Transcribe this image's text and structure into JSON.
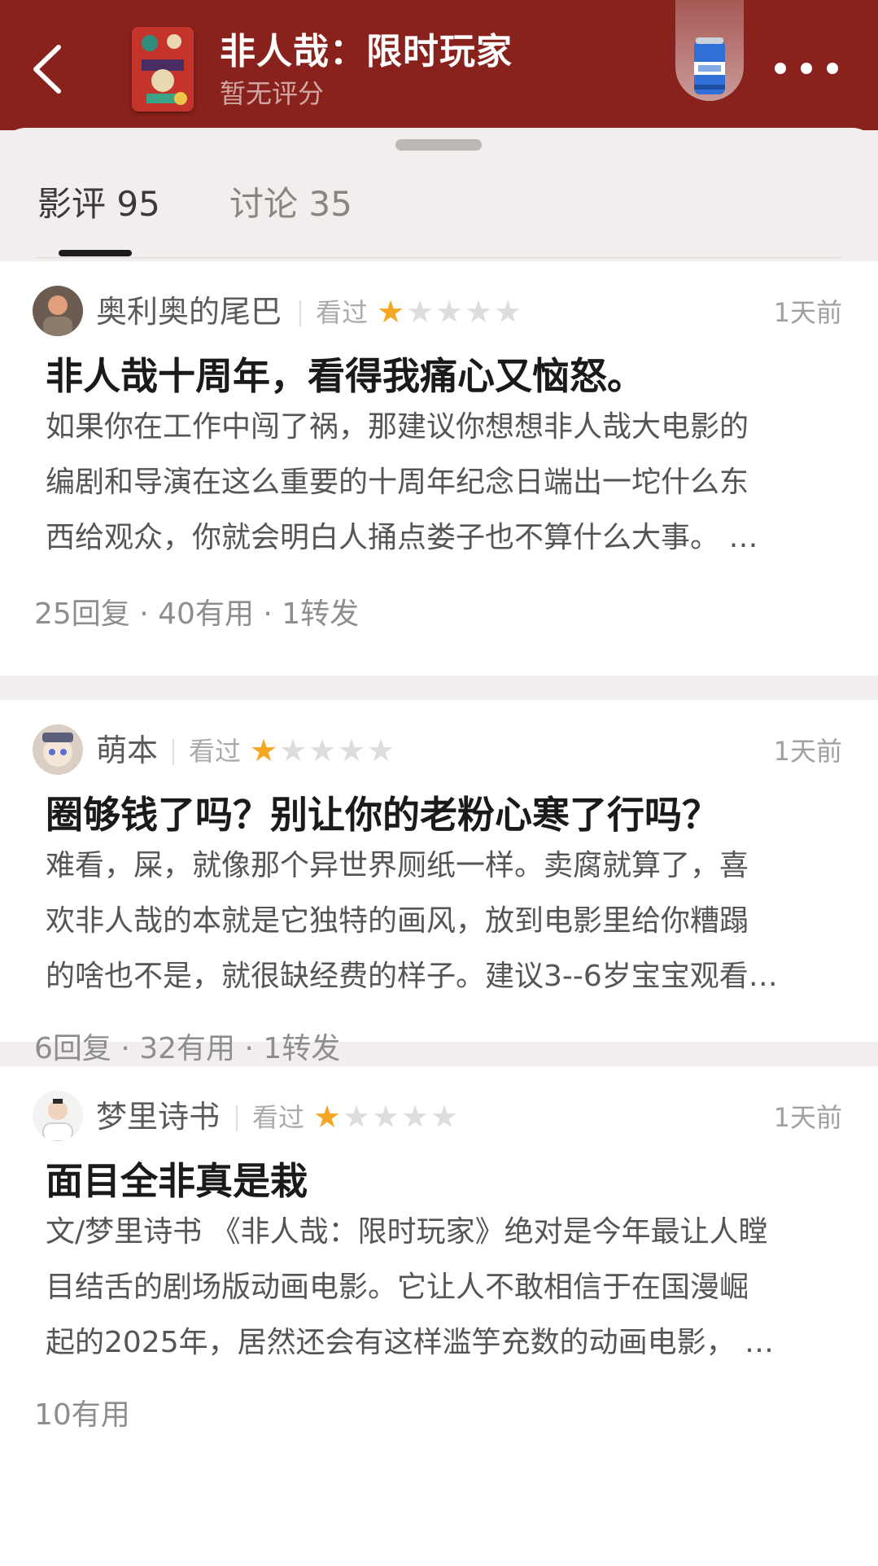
{
  "header": {
    "title": "非人哉：限时玩家",
    "rating": "暂无评分",
    "poster_icon": "movie-poster",
    "beer_icon": "beer-can-icon",
    "colors": {
      "header_bg": "#89211c",
      "star_on": "#f5a623"
    }
  },
  "tabs": [
    {
      "label": "影评 95",
      "active": true
    },
    {
      "label": "讨论 35",
      "active": false
    }
  ],
  "reviews": [
    {
      "author": "奥利奥的尾巴",
      "status": "看过",
      "stars": 1,
      "time": "1天前",
      "title": "非人哉十周年，看得我痛心又恼怒。",
      "body": [
        "如果你在工作中闯了祸，那建议你想想非人哉大电影的",
        "编剧和导演在这么重要的十周年纪念日端出一坨什么东",
        "西给观众，你就会明白人捅点娄子也不算什么大事。 …"
      ],
      "stats": "25回复 · 40有用 · 1转发"
    },
    {
      "author": "萌本",
      "status": "看过",
      "stars": 1,
      "time": "1天前",
      "title": "圈够钱了吗？别让你的老粉心寒了行吗？",
      "body": [
        "难看，屎，就像那个异世界厕纸一样。卖腐就算了，喜",
        "欢非人哉的本就是它独特的画风，放到电影里给你糟蹋",
        "的啥也不是，就很缺经费的样子。建议3--6岁宝宝观看…"
      ],
      "stats": "6回复 · 32有用 · 1转发"
    },
    {
      "author": "梦里诗书",
      "status": "看过",
      "stars": 1,
      "time": "1天前",
      "title": "面目全非真是栽",
      "body": [
        "文/梦里诗书 《非人哉：限时玩家》绝对是今年最让人瞠",
        "目结舌的剧场版动画电影。它让人不敢相信于在国漫崛",
        "起的2025年，居然还会有这样滥竽充数的动画电影， …"
      ],
      "stats": "10有用"
    }
  ]
}
